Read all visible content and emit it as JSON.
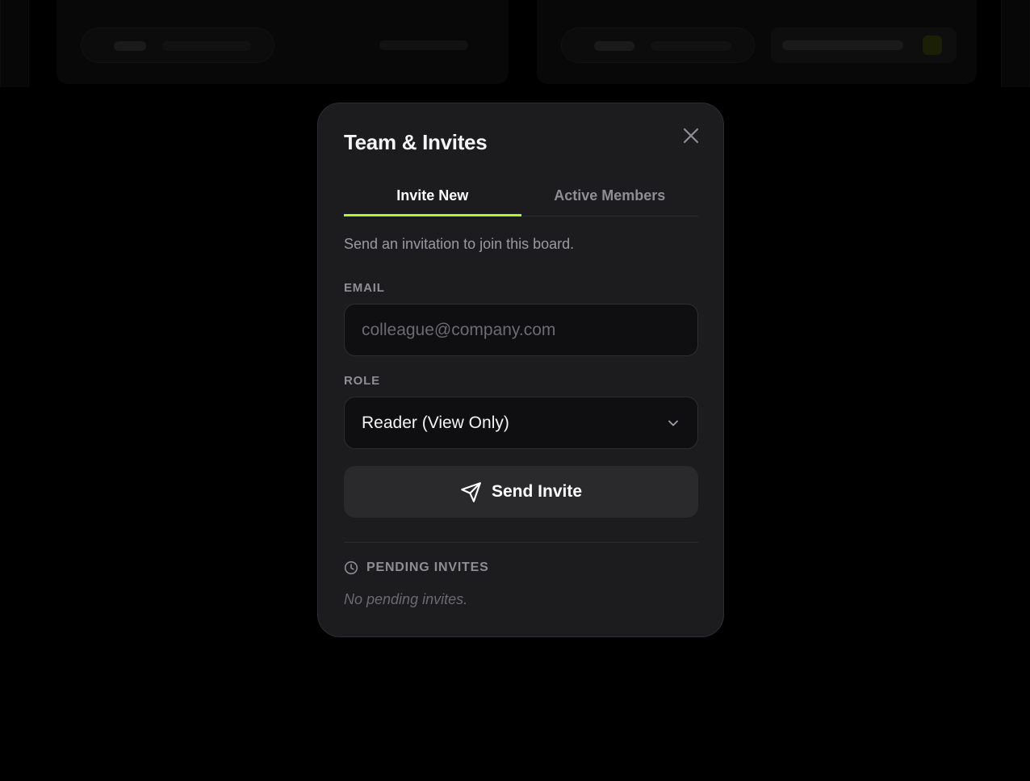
{
  "modal": {
    "title": "Team & Invites",
    "tabs": [
      {
        "label": "Invite New",
        "active": true
      },
      {
        "label": "Active Members",
        "active": false
      }
    ],
    "description": "Send an invitation to join this board.",
    "email": {
      "label": "EMAIL",
      "value": "",
      "placeholder": "colleague@company.com"
    },
    "role": {
      "label": "ROLE",
      "selected": "Reader (View Only)"
    },
    "send_button": {
      "label": "Send Invite",
      "icon": "send-icon"
    },
    "pending": {
      "title": "PENDING INVITES",
      "icon": "clock-icon",
      "empty_text": "No pending invites."
    }
  },
  "colors": {
    "accent": "#b5f22a",
    "modal_bg": "#1c1c1e",
    "input_bg": "#0f0f11",
    "button_bg": "#2a2a2d"
  }
}
